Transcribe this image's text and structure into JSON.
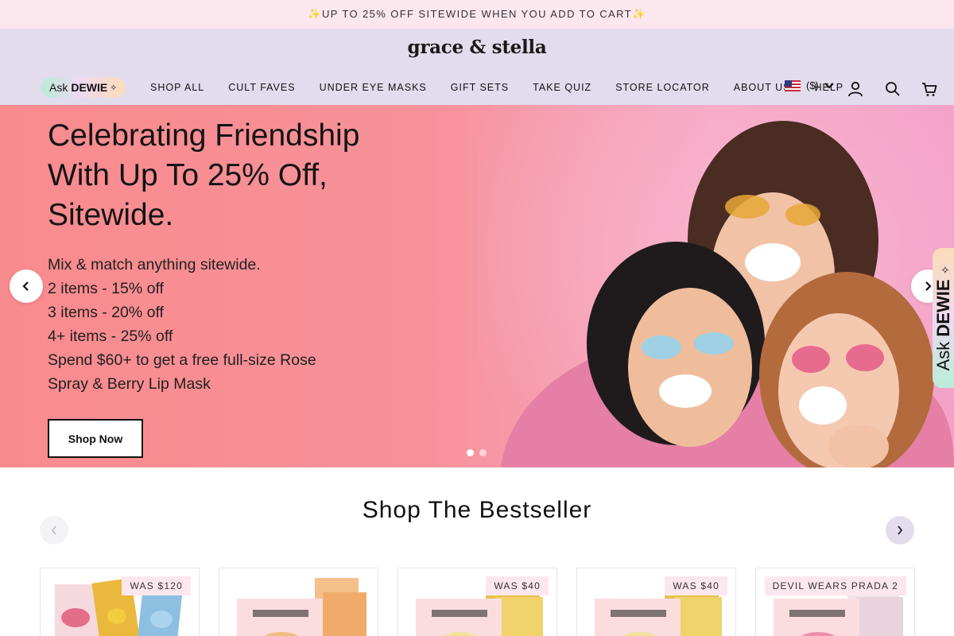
{
  "announcement": "✨UP TO 25% OFF SITEWIDE WHEN YOU ADD TO CART✨",
  "header": {
    "logo": "grace & stella",
    "ask_prefix": "Ask",
    "ask_name": "DEWIE",
    "ask_spark": "✧",
    "nav": [
      "SHOP ALL",
      "CULT FAVES",
      "UNDER EYE MASKS",
      "GIFT SETS",
      "TAKE QUIZ",
      "STORE LOCATOR",
      "ABOUT US",
      "HELP"
    ],
    "currency": "($)",
    "icons": [
      "account-icon",
      "search-icon",
      "cart-icon"
    ]
  },
  "hero": {
    "title": "Celebrating Friendship With Up To 25% Off, Sitewide.",
    "lines": [
      "Mix & match anything sitewide.",
      "2 items - 15% off",
      "3 items - 20% off",
      "4+ items - 25% off",
      "Spend $60+ to get a free full-size Rose",
      "Spray & Berry Lip Mask"
    ],
    "button": "Shop Now",
    "slide_count": 2,
    "active_slide": 1
  },
  "side_tab": {
    "prefix": "Ask",
    "name": "DEWIE",
    "spark": "✧"
  },
  "bestseller": {
    "title": "Shop The Bestseller",
    "cards": [
      {
        "badge": "WAS $120"
      },
      {
        "badge": ""
      },
      {
        "badge": "WAS $40"
      },
      {
        "badge": "WAS $40"
      },
      {
        "badge": "DEVIL WEARS PRADA 2"
      }
    ]
  },
  "colors": {
    "announcement_bg": "#fde7ef",
    "header_bg": "#e2dced",
    "hero_bg": "#f88b8e",
    "badge_bg": "#fde7ef"
  }
}
